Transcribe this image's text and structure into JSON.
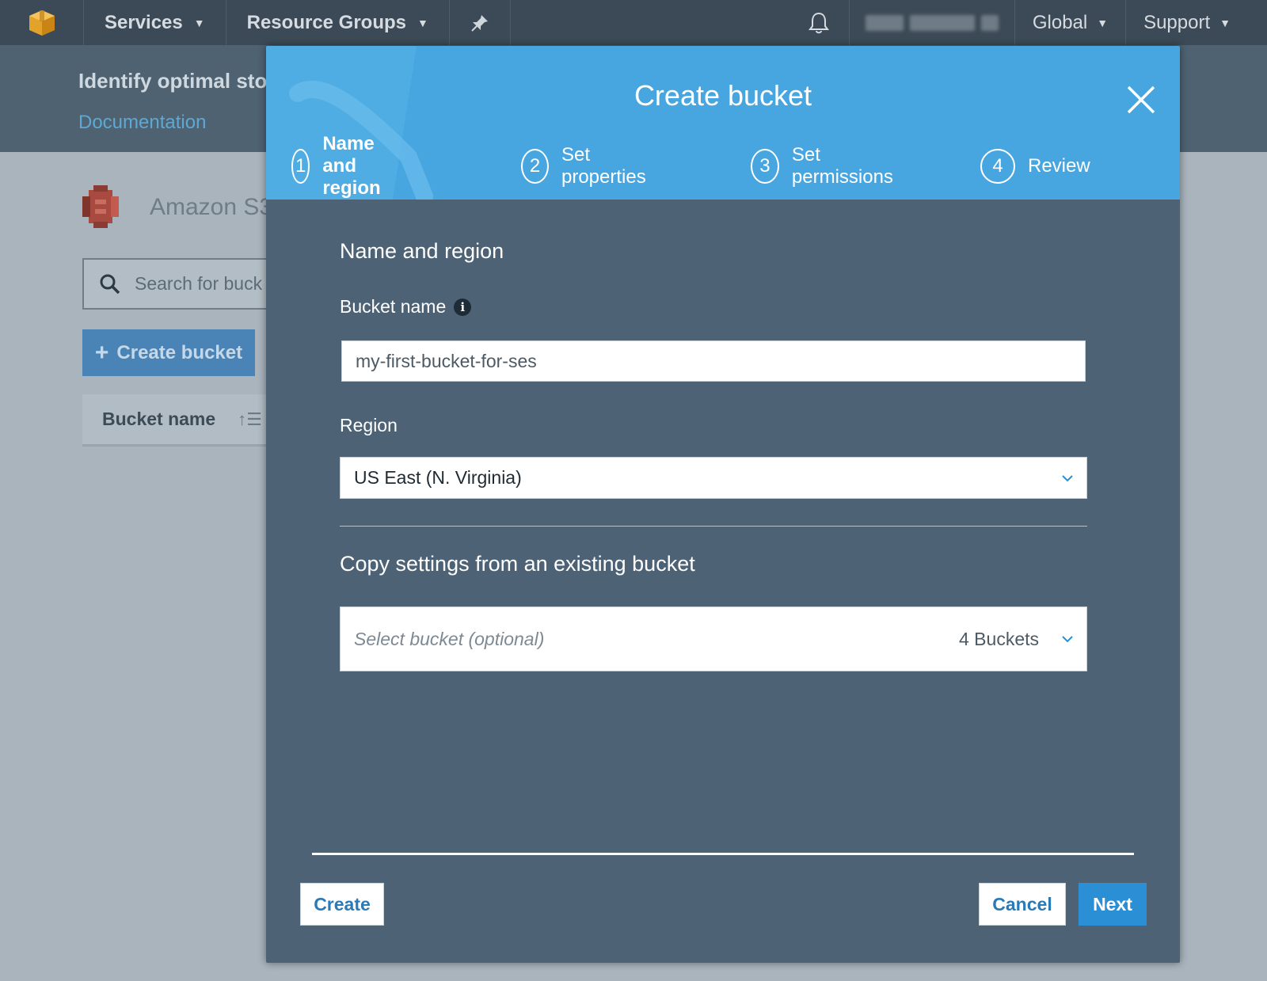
{
  "topnav": {
    "services": "Services",
    "resource_groups": "Resource Groups",
    "region": "Global",
    "support": "Support"
  },
  "background": {
    "header_title": "Identify optimal sto",
    "documentation_link": "Documentation",
    "app_title": "Amazon S3",
    "search_placeholder": "Search for buck",
    "create_bucket_button": "Create bucket",
    "table_header_bucket_name": "Bucket name"
  },
  "modal": {
    "title": "Create bucket",
    "steps": [
      {
        "number": "1",
        "label": "Name and region",
        "active": true
      },
      {
        "number": "2",
        "label": "Set properties",
        "active": false
      },
      {
        "number": "3",
        "label": "Set permissions",
        "active": false
      },
      {
        "number": "4",
        "label": "Review",
        "active": false
      }
    ],
    "section_title": "Name and region",
    "bucket_name_label": "Bucket name",
    "bucket_name_value": "my-first-bucket-for-ses",
    "region_label": "Region",
    "region_value": "US East (N. Virginia)",
    "copy_settings_title": "Copy settings from an existing bucket",
    "select_bucket_placeholder": "Select bucket (optional)",
    "bucket_count": "4 Buckets",
    "buttons": {
      "create": "Create",
      "cancel": "Cancel",
      "next": "Next"
    }
  },
  "icons": {
    "aws_logo": "cube-icon",
    "pin": "pin-icon",
    "notifications": "bell-icon",
    "close": "close-icon",
    "info": "info-icon",
    "dropdown": "chevron-down-icon",
    "search": "search-icon",
    "add": "plus-icon",
    "sort": "sort-icon"
  },
  "colors": {
    "nav_bg": "#3b4a56",
    "modal_header": "#47a6e0",
    "modal_body": "#4d6275",
    "primary_button": "#2b8fd6",
    "link": "#2a7ab8"
  }
}
